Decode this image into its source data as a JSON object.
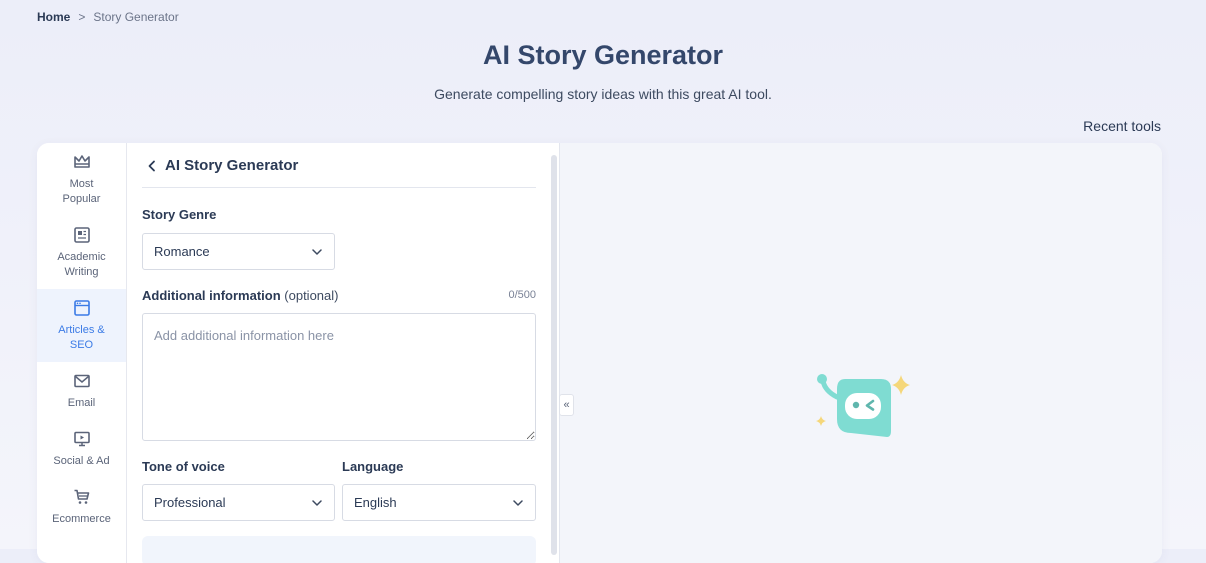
{
  "breadcrumb": {
    "home": "Home",
    "separator": ">",
    "current": "Story Generator"
  },
  "header": {
    "title": "AI Story Generator",
    "subtitle": "Generate compelling story ideas with this great AI tool."
  },
  "recent_tools": "Recent tools",
  "sidebar": {
    "items": [
      {
        "label": "Most\nPopular",
        "icon": "crown-icon",
        "active": false
      },
      {
        "label": "Academic\nWriting",
        "icon": "newspaper-icon",
        "active": false
      },
      {
        "label": "Articles &\nSEO",
        "icon": "browser-window-icon",
        "active": true
      },
      {
        "label": "Email",
        "icon": "envelope-icon",
        "active": false
      },
      {
        "label": "Social & Ad",
        "icon": "monitor-play-icon",
        "active": false
      },
      {
        "label": "Ecommerce",
        "icon": "shopping-cart-icon",
        "active": false
      }
    ]
  },
  "form": {
    "tool_title": "AI Story Generator",
    "genre": {
      "label": "Story Genre",
      "value": "Romance"
    },
    "additional": {
      "label": "Additional information",
      "optional": "(optional)",
      "counter": "0/500",
      "placeholder": "Add additional information here"
    },
    "tone": {
      "label": "Tone of voice",
      "value": "Professional"
    },
    "language": {
      "label": "Language",
      "value": "English"
    }
  },
  "preview": {
    "collapse_icon": "«"
  },
  "colors": {
    "accent": "#3b7be6",
    "robot": "#7fdcd2",
    "sparkle": "#f5d77a"
  }
}
